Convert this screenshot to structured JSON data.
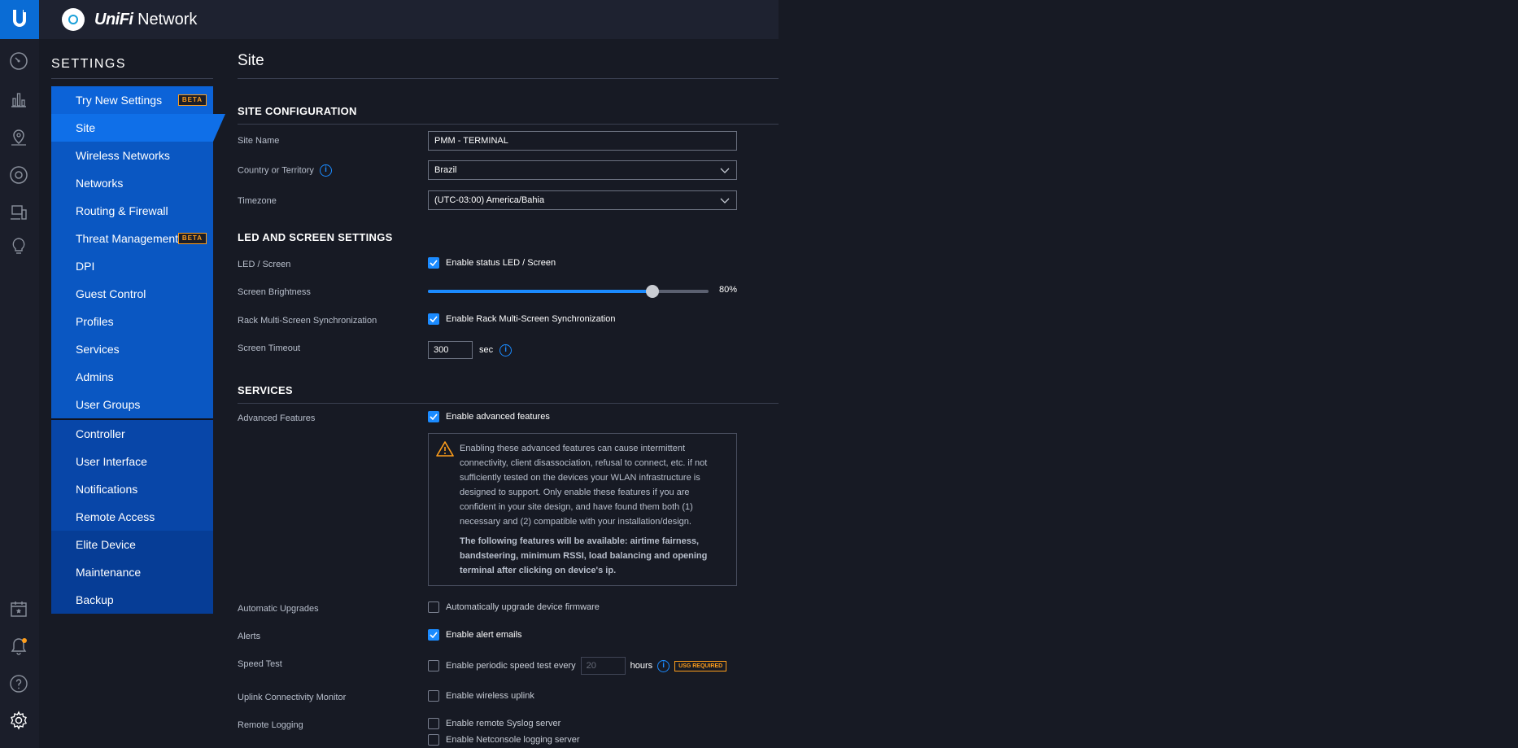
{
  "brand": {
    "unifi": "UniFi",
    "network": "Network"
  },
  "sidebar": {
    "title": "SETTINGS",
    "beta_label": "BETA",
    "items": [
      {
        "label": "Try New Settings",
        "badge": "BETA"
      },
      {
        "label": "Site"
      },
      {
        "label": "Wireless Networks"
      },
      {
        "label": "Networks"
      },
      {
        "label": "Routing & Firewall"
      },
      {
        "label": "Threat Management",
        "badge": "BETA"
      },
      {
        "label": "DPI"
      },
      {
        "label": "Guest Control"
      },
      {
        "label": "Profiles"
      },
      {
        "label": "Services"
      },
      {
        "label": "Admins"
      },
      {
        "label": "User Groups"
      },
      {
        "label": "Controller"
      },
      {
        "label": "User Interface"
      },
      {
        "label": "Notifications"
      },
      {
        "label": "Remote Access"
      },
      {
        "label": "Elite Device"
      },
      {
        "label": "Maintenance"
      },
      {
        "label": "Backup"
      }
    ]
  },
  "main": {
    "title": "Site",
    "site_config": {
      "heading": "SITE CONFIGURATION",
      "site_name_label": "Site Name",
      "site_name_value": "PMM - TERMINAL",
      "country_label": "Country or Territory",
      "country_value": "Brazil",
      "timezone_label": "Timezone",
      "timezone_value": "(UTC-03:00) America/Bahia"
    },
    "led": {
      "heading": "LED AND SCREEN SETTINGS",
      "led_label": "LED / Screen",
      "led_checkbox": "Enable status LED / Screen",
      "brightness_label": "Screen Brightness",
      "brightness_value": 0.8,
      "brightness_text": "80%",
      "rack_label": "Rack Multi-Screen Synchronization",
      "rack_checkbox": "Enable Rack Multi-Screen Synchronization",
      "timeout_label": "Screen Timeout",
      "timeout_value": "300",
      "timeout_unit": "sec"
    },
    "services": {
      "heading": "SERVICES",
      "advanced_label": "Advanced Features",
      "advanced_checkbox": "Enable advanced features",
      "warning_text": "Enabling these advanced features can cause intermittent connectivity, client disassociation, refusal to connect, etc. if not sufficiently tested on the devices your WLAN infrastructure is designed to support. Only enable these features if you are confident in your site design, and have found them both (1) necessary and (2) compatible with your installation/design.",
      "warning_bold": "The following features will be available: airtime fairness, bandsteering, minimum RSSI, load balancing and opening terminal after clicking on device's ip.",
      "upgrades_label": "Automatic Upgrades",
      "upgrades_checkbox": "Automatically upgrade device firmware",
      "alerts_label": "Alerts",
      "alerts_checkbox": "Enable alert emails",
      "speed_label": "Speed Test",
      "speed_checkbox": "Enable periodic speed test every",
      "speed_value": "20",
      "speed_unit": "hours",
      "usg_badge": "USG REQUIRED",
      "uplink_label": "Uplink Connectivity Monitor",
      "uplink_checkbox": "Enable wireless uplink",
      "logging_label": "Remote Logging",
      "syslog_checkbox": "Enable remote Syslog server",
      "netconsole_checkbox": "Enable Netconsole logging server"
    }
  },
  "colors": {
    "accent": "#1b8bff",
    "nav_blue": "#0a57c2",
    "warning": "#ff9e1b",
    "background": "#171a24"
  }
}
